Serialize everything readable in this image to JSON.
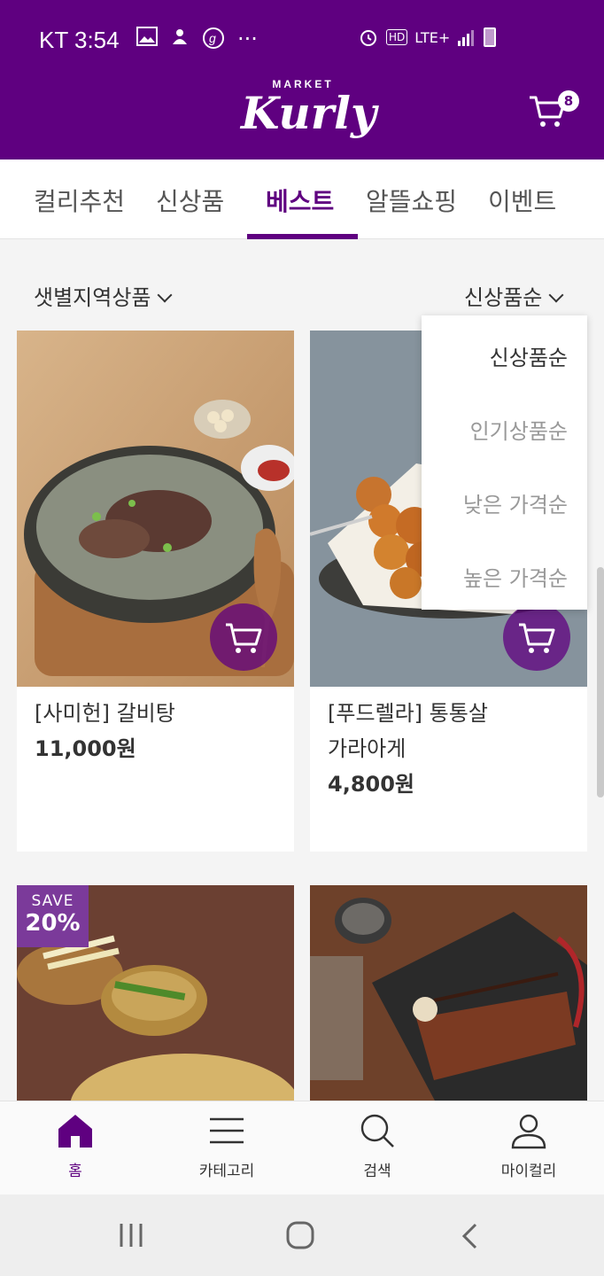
{
  "status_bar": {
    "carrier": "KT",
    "time": "3:54",
    "network": "LTE+",
    "hd": "HD",
    "more": "···",
    "left_icons": [
      "image-icon",
      "upload-icon",
      "g-icon"
    ],
    "right_icons": [
      "alarm-icon",
      "hd-icon",
      "signal-icon",
      "battery-icon"
    ]
  },
  "header": {
    "logo_top": "MARKET",
    "logo_main": "Kurly",
    "cart_count": "8",
    "color": "#5f0080"
  },
  "tabs": [
    {
      "label": "컬리추천",
      "active": false
    },
    {
      "label": "신상품",
      "active": false
    },
    {
      "label": "베스트",
      "active": true
    },
    {
      "label": "알뜰쇼핑",
      "active": false
    },
    {
      "label": "이벤트",
      "active": false
    }
  ],
  "filter": {
    "left": "샛별지역상품",
    "right": "신상품순"
  },
  "sort_dropdown": {
    "options": [
      "신상품순",
      "인기상품순",
      "낮은 가격순",
      "높은 가격순"
    ],
    "selected": "신상품순"
  },
  "products": [
    {
      "name": "[사미헌] 갈비탕",
      "price": "11,000원"
    },
    {
      "name_line1": "[푸드렐라] 통통살",
      "name_line2": "가라아게",
      "price": "4,800원"
    },
    {
      "badge_top": "SAVE",
      "badge_value": "20%"
    },
    {}
  ],
  "bottom_nav": [
    {
      "label": "홈",
      "icon": "home-icon",
      "active": true
    },
    {
      "label": "카테고리",
      "icon": "menu-icon",
      "active": false
    },
    {
      "label": "검색",
      "icon": "search-icon",
      "active": false
    },
    {
      "label": "마이컬리",
      "icon": "user-icon",
      "active": false
    }
  ],
  "system_nav": [
    "recent-apps-icon",
    "home-circle-icon",
    "back-icon"
  ]
}
